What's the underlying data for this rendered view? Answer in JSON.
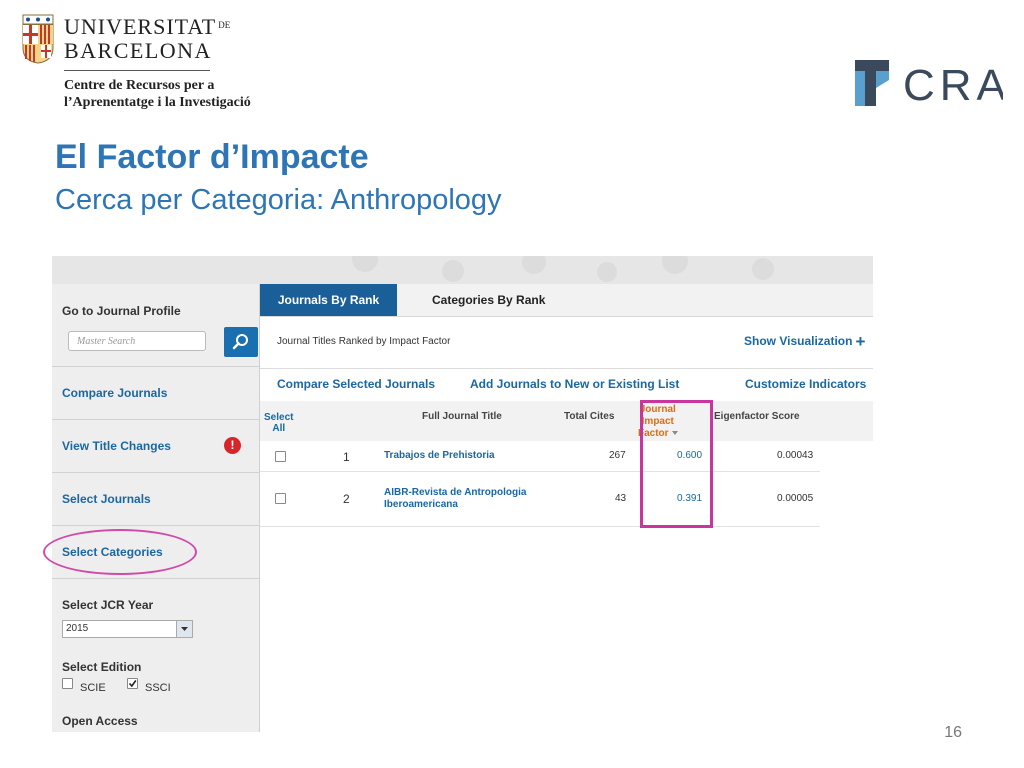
{
  "header": {
    "university_line1": "UNIVERSITAT",
    "university_de": "DE",
    "university_line2": "BARCELONA",
    "centre_line1": "Centre de Recursos per a",
    "centre_line2": "l’Aprenentatge i la Investigació",
    "crai_logo_text": "CRAI"
  },
  "slide": {
    "title": "El Factor d’Impacte",
    "subtitle": "Cerca per Categoria: Anthropology",
    "page_number": "16"
  },
  "sidebar": {
    "journal_profile_label": "Go to Journal Profile",
    "search_placeholder": "Master Search",
    "links": {
      "compare": "Compare Journals",
      "view_title_changes": "View Title Changes",
      "select_journals": "Select Journals",
      "select_categories": "Select Categories"
    },
    "alert_glyph": "!",
    "jcr_year_label": "Select JCR Year",
    "jcr_year_value": "2015",
    "edition_label": "Select Edition",
    "editions": [
      {
        "label": "SCIE",
        "checked": false
      },
      {
        "label": "SSCI",
        "checked": true
      }
    ],
    "open_access_label": "Open Access"
  },
  "tabs": {
    "active": "Journals By Rank",
    "other": "Categories By Rank"
  },
  "main": {
    "ranked_title": "Journal Titles Ranked by Impact Factor",
    "show_visualization": "Show Visualization",
    "plus_glyph": "+",
    "actions": {
      "compare_selected": "Compare Selected Journals",
      "add_journals": "Add Journals to New or Existing List",
      "customize": "Customize Indicators"
    }
  },
  "table": {
    "headers": {
      "select_line1": "Select",
      "select_line2": "All",
      "title": "Full Journal Title",
      "total_cites": "Total Cites",
      "jif_line1": "Journal",
      "jif_line2": "Impact",
      "jif_line3": "Factor",
      "eigenfactor": "Eigenfactor Score"
    },
    "rows": [
      {
        "rank": "1",
        "title_line1": "Trabajos de Prehistoria",
        "title_line2": "",
        "total_cites": "267",
        "jif": "0.600",
        "eigenfactor": "0.00043"
      },
      {
        "rank": "2",
        "title_line1": "AIBR-Revista de Antropologia",
        "title_line2": "Iberoamericana",
        "total_cites": "43",
        "jif": "0.391",
        "eigenfactor": "0.00005"
      }
    ]
  },
  "colors": {
    "title_blue": "#2e75b6",
    "link_blue": "#1a67a3",
    "tab_active": "#1a5f98",
    "highlight_magenta": "#c9359e",
    "jif_header_orange": "#e46c0a",
    "alert_red": "#d6262a"
  }
}
